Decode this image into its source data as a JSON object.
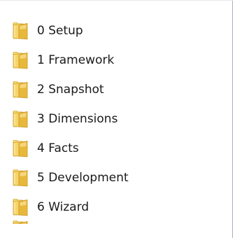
{
  "folders": [
    {
      "name": "0 Setup",
      "icon": "folder-icon"
    },
    {
      "name": "1 Framework",
      "icon": "folder-icon"
    },
    {
      "name": "2 Snapshot",
      "icon": "folder-icon"
    },
    {
      "name": "3 Dimensions",
      "icon": "folder-icon"
    },
    {
      "name": "4 Facts",
      "icon": "folder-icon"
    },
    {
      "name": "5 Development",
      "icon": "folder-icon"
    },
    {
      "name": "6 Wizard",
      "icon": "folder-icon"
    }
  ],
  "colors": {
    "folder_front": "#e7b83a",
    "folder_back": "#f6d56d",
    "folder_shade": "#c8951e",
    "border": "#a7b0bc",
    "text": "#1a1a1a"
  }
}
